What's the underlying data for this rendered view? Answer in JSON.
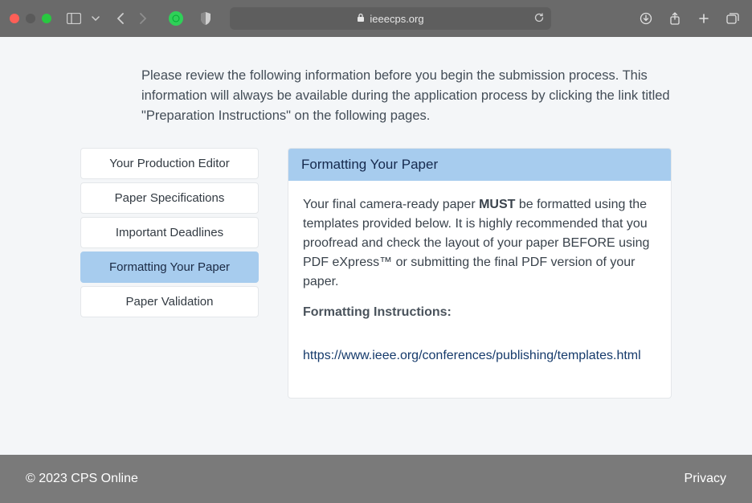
{
  "browser": {
    "domain": "ieeecps.org"
  },
  "intro": "Please review the following information before you begin the submission process. This information will always be available during the application process by clicking the link titled \"Preparation Instructions\" on the following pages.",
  "sidebar": {
    "items": [
      {
        "label": "Your Production Editor"
      },
      {
        "label": "Paper Specifications"
      },
      {
        "label": "Important Deadlines"
      },
      {
        "label": "Formatting Your Paper"
      },
      {
        "label": "Paper Validation"
      }
    ],
    "activeIndex": 3
  },
  "panel": {
    "title": "Formatting Your Paper",
    "body_prefix": "Your final camera-ready paper ",
    "body_bold": "MUST",
    "body_suffix": " be formatted using the templates provided below. It is highly recommended that you proofread and check the layout of your paper BEFORE using PDF eXpress™ or submitting the final PDF version of your paper.",
    "subhead": "Formatting Instructions:",
    "link_text": "https://www.ieee.org/conferences/publishing/templates.html"
  },
  "footer": {
    "copyright": "© 2023 CPS Online",
    "privacy": "Privacy"
  }
}
